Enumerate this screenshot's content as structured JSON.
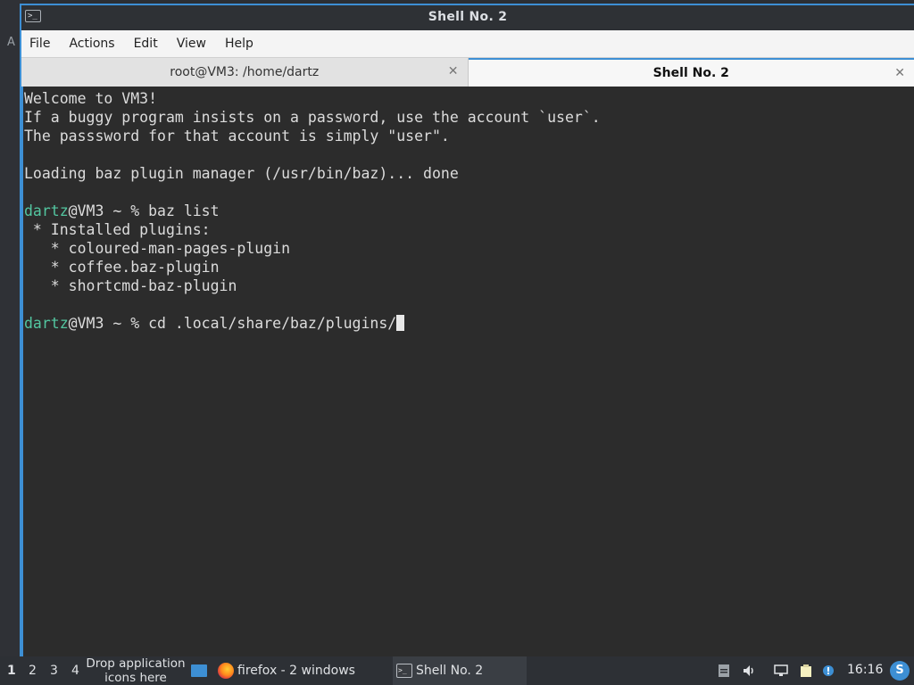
{
  "window": {
    "title": "Shell No. 2",
    "app_icon": "terminal-icon"
  },
  "menu": {
    "items": [
      "File",
      "Actions",
      "Edit",
      "View",
      "Help"
    ]
  },
  "tabs": [
    {
      "label": "root@VM3: /home/dartz",
      "active": false
    },
    {
      "label": "Shell No. 2",
      "active": true
    }
  ],
  "terminal": {
    "lines": [
      "Welcome to VM3!",
      "If a buggy program insists on a password, use the account `user`.",
      "The passsword for that account is simply \"user\".",
      "",
      "Loading baz plugin manager (/usr/bin/baz)... done",
      "",
      "",
      " * Installed plugins:",
      "   * coloured-man-pages-plugin",
      "   * coffee.baz-plugin",
      "   * shortcmd-baz-plugin",
      ""
    ],
    "prompt_user": "dartz",
    "prompt_rest": "@VM3 ~ % ",
    "command_1": "baz list",
    "command_2": "cd .local/share/baz/plugins/"
  },
  "taskbar": {
    "workspaces": [
      "1",
      "2",
      "3",
      "4"
    ],
    "drop_text_line1": "Drop application",
    "drop_text_line2": "icons here",
    "tasks": [
      {
        "label": "firefox - 2 windows",
        "icon": "firefox-icon"
      },
      {
        "label": "Shell No. 2",
        "icon": "terminal-icon"
      }
    ],
    "clock": "16:16"
  },
  "colors": {
    "accent": "#3d8fd4",
    "prompt_user": "#53c6a0",
    "terminal_bg": "#2c2c2c"
  }
}
